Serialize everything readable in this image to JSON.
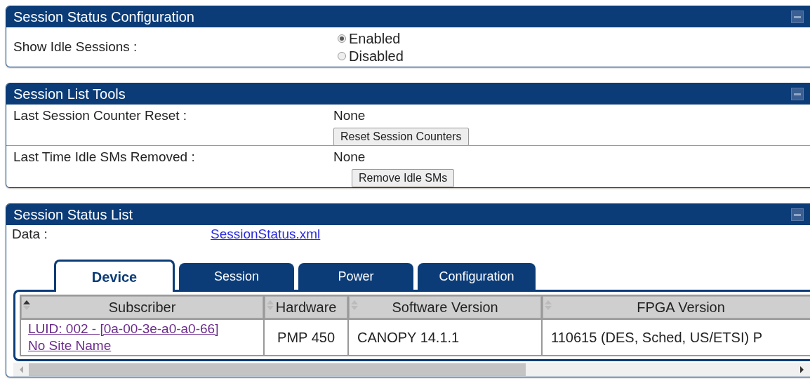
{
  "config_panel": {
    "title": "Session Status Configuration",
    "field_label": "Show Idle Sessions :",
    "options": [
      {
        "label": "Enabled",
        "selected": true
      },
      {
        "label": "Disabled",
        "selected": false
      }
    ]
  },
  "tools_panel": {
    "title": "Session List Tools",
    "rows": [
      {
        "label": "Last Session Counter Reset :",
        "value": "None",
        "button": "Reset Session Counters"
      },
      {
        "label": "Last Time Idle SMs Removed :",
        "value": "None",
        "button": "Remove Idle SMs"
      }
    ]
  },
  "list_panel": {
    "title": "Session Status List",
    "data_label": "Data :",
    "data_link": "SessionStatus.xml",
    "tabs": [
      {
        "label": "Device",
        "selected": true
      },
      {
        "label": "Session",
        "selected": false
      },
      {
        "label": "Power",
        "selected": false
      },
      {
        "label": "Configuration",
        "selected": false
      }
    ],
    "table": {
      "columns": [
        "Subscriber",
        "Hardware",
        "Software Version",
        "FPGA Version"
      ],
      "rows": [
        {
          "subscriber": [
            "LUID: 002 - [0a-00-3e-a0-a0-66]",
            "No Site Name"
          ],
          "hardware": "PMP 450",
          "software_version": "CANOPY 14.1.1",
          "fpga_version": "110615 (DES, Sched, US/ETSI) P"
        }
      ]
    }
  }
}
